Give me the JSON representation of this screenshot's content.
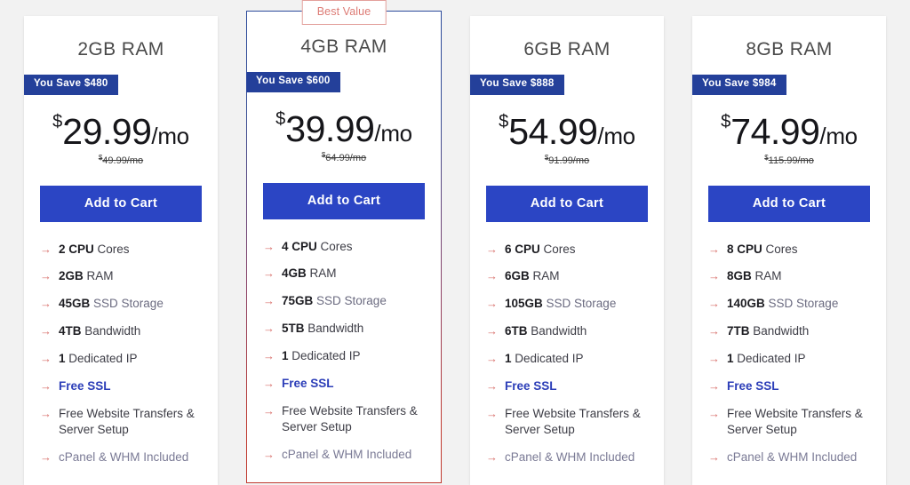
{
  "background_color": "#f2f2f2",
  "accent": {
    "button_blue": "#2b45c4",
    "badge_navy": "#24409a",
    "arrow_red": "#d9716d",
    "ssl_blue": "#2c3eb8",
    "best_value_border": "#e3a09c",
    "featured_border_top": "#2b4a9b",
    "featured_border_bottom": "#c0392f"
  },
  "plans": [
    {
      "title": "2GB RAM",
      "featured": false,
      "badge_label": null,
      "save_label": "You Save $480",
      "currency": "$",
      "price": "29.99",
      "period": "/mo",
      "old_currency": "$",
      "old_price": "49.99/mo",
      "cta_label": "Add to Cart",
      "features": [
        {
          "arrow": "→",
          "strong": "2 CPU",
          "normal": " Cores",
          "style": "normal"
        },
        {
          "arrow": "→",
          "strong": "2GB",
          "normal": " RAM",
          "style": "normal"
        },
        {
          "arrow": "→",
          "strong": "45GB",
          "normal": " SSD Storage",
          "style": "muted"
        },
        {
          "arrow": "→",
          "strong": "4TB",
          "normal": " Bandwidth",
          "style": "normal"
        },
        {
          "arrow": "→",
          "strong": "1",
          "normal": " Dedicated IP",
          "style": "normal"
        },
        {
          "arrow": "→",
          "strong": "",
          "normal": "Free SSL",
          "style": "ssl"
        },
        {
          "arrow": "→",
          "strong": "",
          "normal": "Free Website Transfers & Server Setup",
          "style": "normal"
        },
        {
          "arrow": "→",
          "strong": "",
          "normal": "cPanel & WHM Included",
          "style": "cpanel"
        }
      ]
    },
    {
      "title": "4GB RAM",
      "featured": true,
      "badge_label": "Best Value",
      "save_label": "You Save $600",
      "currency": "$",
      "price": "39.99",
      "period": "/mo",
      "old_currency": "$",
      "old_price": "64.99/mo",
      "cta_label": "Add to Cart",
      "features": [
        {
          "arrow": "→",
          "strong": "4 CPU",
          "normal": " Cores",
          "style": "normal"
        },
        {
          "arrow": "→",
          "strong": "4GB",
          "normal": " RAM",
          "style": "normal"
        },
        {
          "arrow": "→",
          "strong": "75GB",
          "normal": " SSD Storage",
          "style": "muted"
        },
        {
          "arrow": "→",
          "strong": "5TB",
          "normal": " Bandwidth",
          "style": "normal"
        },
        {
          "arrow": "→",
          "strong": "1",
          "normal": " Dedicated IP",
          "style": "normal"
        },
        {
          "arrow": "→",
          "strong": "",
          "normal": "Free SSL",
          "style": "ssl"
        },
        {
          "arrow": "→",
          "strong": "",
          "normal": "Free Website Transfers & Server Setup",
          "style": "normal"
        },
        {
          "arrow": "→",
          "strong": "",
          "normal": "cPanel & WHM Included",
          "style": "cpanel"
        }
      ]
    },
    {
      "title": "6GB RAM",
      "featured": false,
      "badge_label": null,
      "save_label": "You Save $888",
      "currency": "$",
      "price": "54.99",
      "period": "/mo",
      "old_currency": "$",
      "old_price": "91.99/mo",
      "cta_label": "Add to Cart",
      "features": [
        {
          "arrow": "→",
          "strong": "6 CPU",
          "normal": " Cores",
          "style": "normal"
        },
        {
          "arrow": "→",
          "strong": "6GB",
          "normal": " RAM",
          "style": "normal"
        },
        {
          "arrow": "→",
          "strong": "105GB",
          "normal": " SSD Storage",
          "style": "muted"
        },
        {
          "arrow": "→",
          "strong": "6TB",
          "normal": " Bandwidth",
          "style": "normal"
        },
        {
          "arrow": "→",
          "strong": "1",
          "normal": " Dedicated IP",
          "style": "normal"
        },
        {
          "arrow": "→",
          "strong": "",
          "normal": "Free SSL",
          "style": "ssl"
        },
        {
          "arrow": "→",
          "strong": "",
          "normal": "Free Website Transfers & Server Setup",
          "style": "normal"
        },
        {
          "arrow": "→",
          "strong": "",
          "normal": "cPanel & WHM Included",
          "style": "cpanel"
        }
      ]
    },
    {
      "title": "8GB RAM",
      "featured": false,
      "badge_label": null,
      "save_label": "You Save $984",
      "currency": "$",
      "price": "74.99",
      "period": "/mo",
      "old_currency": "$",
      "old_price": "115.99/mo",
      "cta_label": "Add to Cart",
      "features": [
        {
          "arrow": "→",
          "strong": "8 CPU",
          "normal": " Cores",
          "style": "normal"
        },
        {
          "arrow": "→",
          "strong": "8GB",
          "normal": " RAM",
          "style": "normal"
        },
        {
          "arrow": "→",
          "strong": "140GB",
          "normal": " SSD Storage",
          "style": "muted"
        },
        {
          "arrow": "→",
          "strong": "7TB",
          "normal": " Bandwidth",
          "style": "normal"
        },
        {
          "arrow": "→",
          "strong": "1",
          "normal": " Dedicated IP",
          "style": "normal"
        },
        {
          "arrow": "→",
          "strong": "",
          "normal": "Free SSL",
          "style": "ssl"
        },
        {
          "arrow": "→",
          "strong": "",
          "normal": "Free Website Transfers & Server Setup",
          "style": "normal"
        },
        {
          "arrow": "→",
          "strong": "",
          "normal": "cPanel & WHM Included",
          "style": "cpanel"
        }
      ]
    }
  ]
}
